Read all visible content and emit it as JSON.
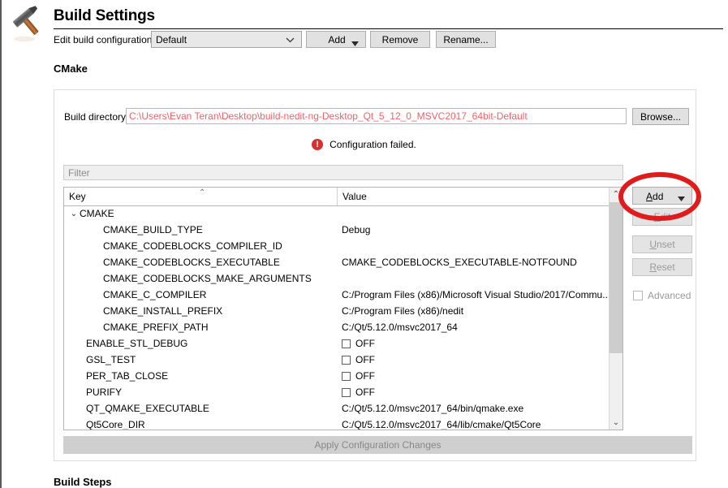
{
  "header": {
    "title": "Build Settings",
    "icon": "hammer-icon"
  },
  "config_row": {
    "label": "Edit build configuration:",
    "combo_value": "Default",
    "combo_chevron": "chevron-down-icon",
    "add_label": "Add",
    "add_chevron": "chevron-down-icon",
    "remove_label": "Remove",
    "rename_label": "Rename..."
  },
  "cmake": {
    "section_title": "CMake",
    "build_directory_label": "Build directory:",
    "build_directory_value": "C:\\Users\\Evan Teran\\Desktop\\build-nedit-ng-Desktop_Qt_5_12_0_MSVC2017_64bit-Default",
    "build_directory_color": "#f4606a",
    "browse_label": "Browse...",
    "error_icon": "error-circle-icon",
    "error_glyph": "!",
    "error_text": "Configuration failed.",
    "error_color": "#d63030",
    "filter_placeholder": "Filter",
    "apply_label": "Apply Configuration Changes",
    "table": {
      "columns": [
        "Key",
        "Value"
      ],
      "sort_indicator": "⌃",
      "rows": [
        {
          "indent": 0,
          "twisty": "⌄",
          "key": "CMAKE",
          "value": "",
          "checkbox": false
        },
        {
          "indent": 2,
          "twisty": "",
          "key": "CMAKE_BUILD_TYPE",
          "value": "Debug",
          "checkbox": false
        },
        {
          "indent": 2,
          "twisty": "",
          "key": "CMAKE_CODEBLOCKS_COMPILER_ID",
          "value": "",
          "checkbox": false
        },
        {
          "indent": 2,
          "twisty": "",
          "key": "CMAKE_CODEBLOCKS_EXECUTABLE",
          "value": "CMAKE_CODEBLOCKS_EXECUTABLE-NOTFOUND",
          "checkbox": false
        },
        {
          "indent": 2,
          "twisty": "",
          "key": "CMAKE_CODEBLOCKS_MAKE_ARGUMENTS",
          "value": "",
          "checkbox": false
        },
        {
          "indent": 2,
          "twisty": "",
          "key": "CMAKE_C_COMPILER",
          "value": "C:/Program Files (x86)/Microsoft Visual Studio/2017/Commu...",
          "checkbox": false
        },
        {
          "indent": 2,
          "twisty": "",
          "key": "CMAKE_INSTALL_PREFIX",
          "value": "C:/Program Files (x86)/nedit",
          "checkbox": false
        },
        {
          "indent": 2,
          "twisty": "",
          "key": "CMAKE_PREFIX_PATH",
          "value": "C:/Qt/5.12.0/msvc2017_64",
          "checkbox": false
        },
        {
          "indent": 1,
          "twisty": "",
          "key": "ENABLE_STL_DEBUG",
          "value": "OFF",
          "checkbox": true
        },
        {
          "indent": 1,
          "twisty": "",
          "key": "GSL_TEST",
          "value": "OFF",
          "checkbox": true
        },
        {
          "indent": 1,
          "twisty": "",
          "key": "PER_TAB_CLOSE",
          "value": "OFF",
          "checkbox": true
        },
        {
          "indent": 1,
          "twisty": "",
          "key": "PURIFY",
          "value": "OFF",
          "checkbox": true
        },
        {
          "indent": 1,
          "twisty": "",
          "key": "QT_QMAKE_EXECUTABLE",
          "value": "C:/Qt/5.12.0/msvc2017_64/bin/qmake.exe",
          "checkbox": false
        },
        {
          "indent": 1,
          "twisty": "",
          "key": "Qt5Core_DIR",
          "value": "C:/Qt/5.12.0/msvc2017_64/lib/cmake/Qt5Core",
          "checkbox": false
        }
      ]
    },
    "side_buttons": {
      "add_label": "Add",
      "add_chevron": "chevron-down-icon",
      "edit_label": "Edit",
      "unset_label": "Unset",
      "reset_label": "Reset",
      "advanced_label": "Advanced"
    },
    "scrollbar": {
      "up_glyph": "⌃",
      "down_glyph": "⌄"
    }
  },
  "build_steps": {
    "section_title": "Build Steps"
  },
  "annotation": {
    "shape": "red-ellipse-highlight",
    "color": "#e01b1b",
    "target": "add-variable-button"
  }
}
